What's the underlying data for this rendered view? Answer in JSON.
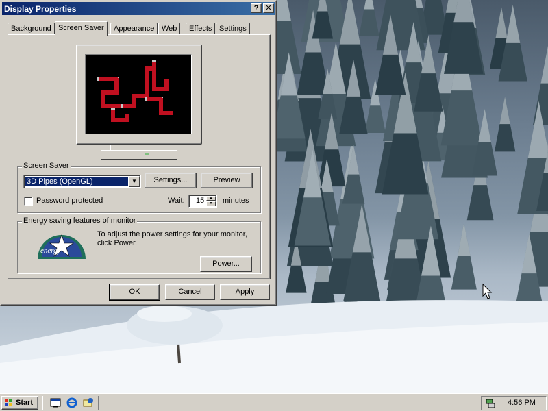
{
  "window": {
    "title": "Display Properties",
    "help_label": "?",
    "close_label": "✕"
  },
  "tabs": [
    {
      "label": "Background"
    },
    {
      "label": "Screen Saver"
    },
    {
      "label": "Appearance"
    },
    {
      "label": "Web"
    },
    {
      "label": "Effects"
    },
    {
      "label": "Settings"
    }
  ],
  "active_tab": "Screen Saver",
  "screen_saver": {
    "group_label": "Screen Saver",
    "selected": "3D Pipes (OpenGL)",
    "settings_label": "Settings...",
    "preview_label": "Preview",
    "password_label": "Password protected",
    "password_checked": false,
    "wait_label": "Wait:",
    "wait_value": "15",
    "wait_units": "minutes"
  },
  "energy": {
    "group_label": "Energy saving features of monitor",
    "description": "To adjust the power settings for your monitor, click Power.",
    "power_label": "Power...",
    "logo_text": "energy"
  },
  "dialog_buttons": {
    "ok": "OK",
    "cancel": "Cancel",
    "apply": "Apply"
  },
  "taskbar": {
    "start_label": "Start",
    "clock": "4:56 PM",
    "quick_launch": [
      "show-desktop-icon",
      "internet-explorer-icon",
      "outlook-express-icon"
    ]
  },
  "colors": {
    "title_start": "#0a246a",
    "title_end": "#3a6ea5",
    "face": "#d4d0c8",
    "selection": "#0a246a"
  }
}
